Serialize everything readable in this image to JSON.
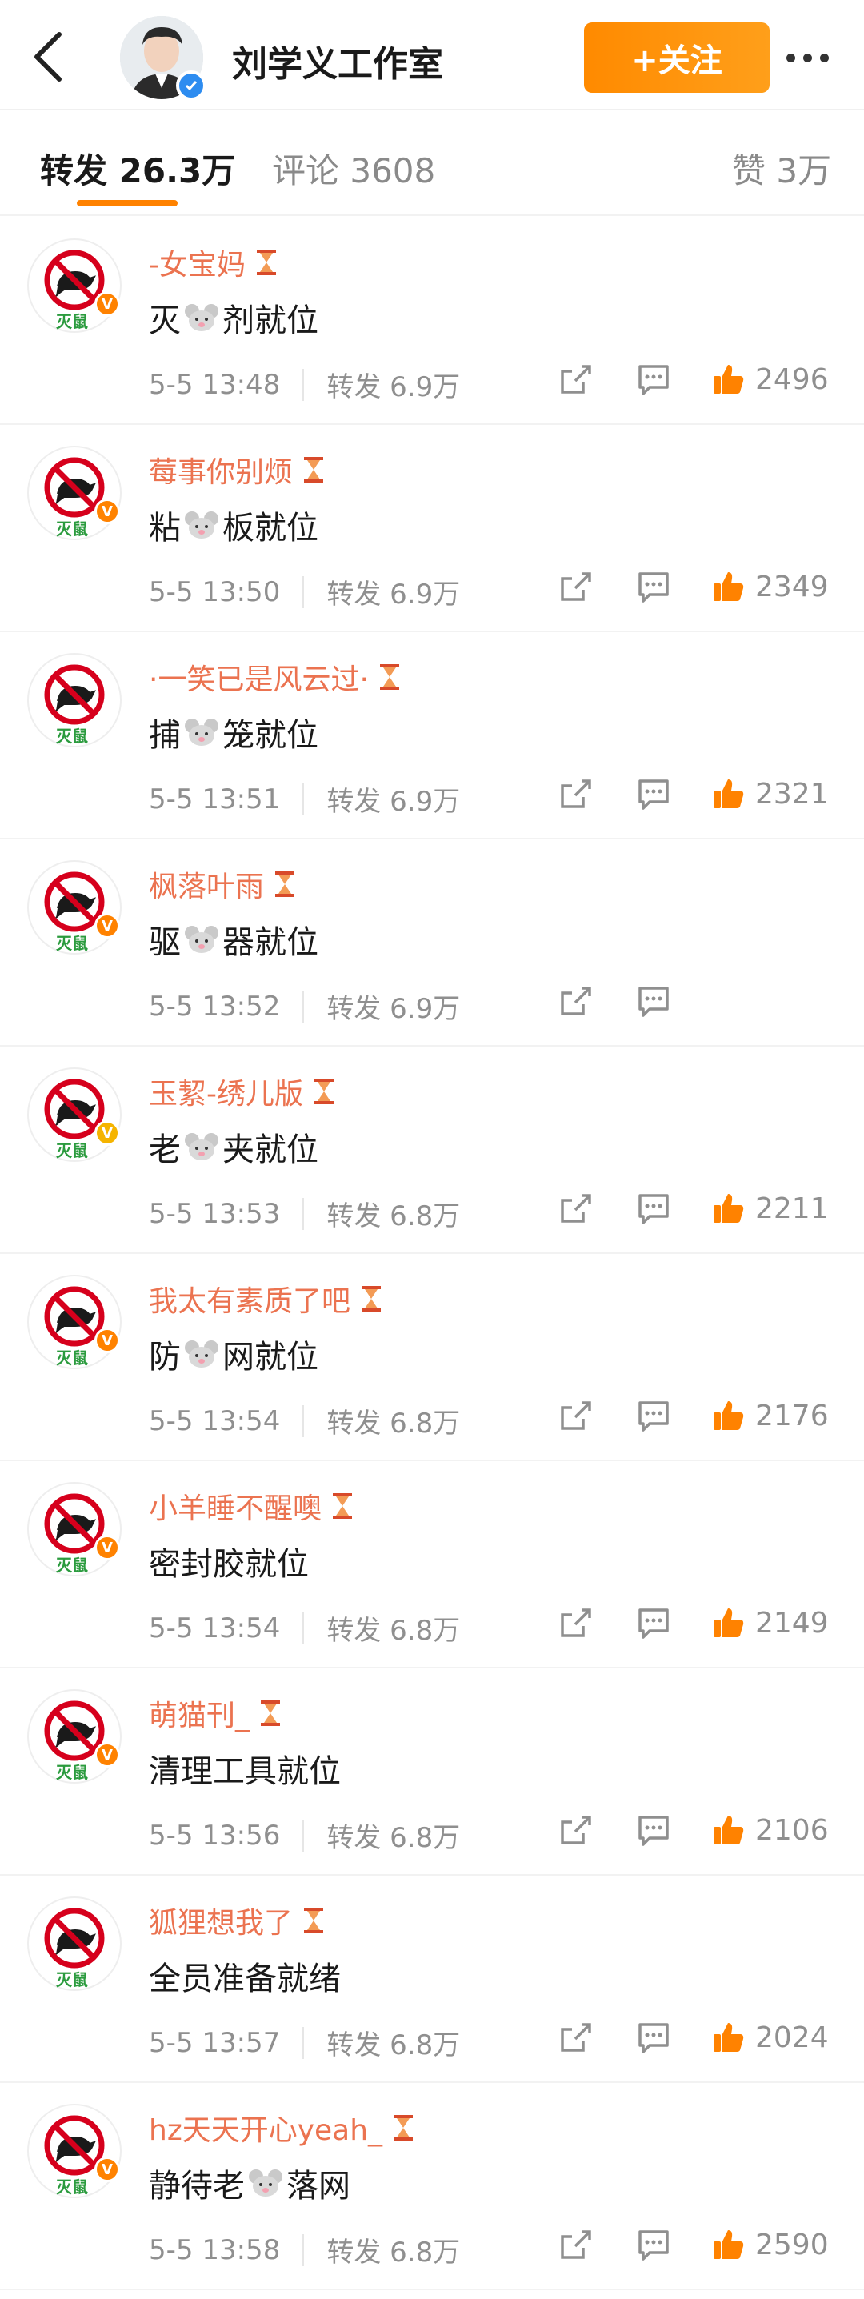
{
  "header": {
    "back_icon": "back-chevron-icon",
    "title": "刘学义工作室",
    "follow_label": "+关注",
    "more_icon": "more-dots-icon"
  },
  "tabs": [
    {
      "label": "转发 26.3万",
      "active": true
    },
    {
      "label": "评论 3608",
      "active": false
    },
    {
      "label": "赞 3万",
      "active": false
    }
  ],
  "avatar_badge_label": "灭鼠",
  "comments": [
    {
      "name": "-女宝妈",
      "text_before": "灭",
      "text_after": "剂就位",
      "time": "5-5 13:48",
      "repost": "转发 6.9万",
      "likes": "2496"
    },
    {
      "name": "莓事你别烦",
      "text_before": "粘",
      "text_after": "板就位",
      "time": "5-5 13:50",
      "repost": "转发 6.9万",
      "likes": "2349"
    },
    {
      "name": "·一笑已是风云过·",
      "text_before": "捕",
      "text_after": "笼就位",
      "time": "5-5 13:51",
      "repost": "转发 6.9万",
      "likes": "2321"
    },
    {
      "name": "枫落叶雨",
      "text_before": "驱",
      "text_after": "器就位",
      "time": "5-5 13:52",
      "repost": "转发 6.9万",
      "likes": ""
    },
    {
      "name": "玉絜-绣儿版",
      "text_before": "老",
      "text_after": "夹就位",
      "time": "5-5 13:53",
      "repost": "转发 6.8万",
      "likes": "2211"
    },
    {
      "name": "我太有素质了吧",
      "text_before": "防",
      "text_after": "网就位",
      "time": "5-5 13:54",
      "repost": "转发 6.8万",
      "likes": "2176"
    },
    {
      "name": "小羊睡不醒噢",
      "text_before": "密封胶就位",
      "text_after": "",
      "time": "5-5 13:54",
      "repost": "转发 6.8万",
      "likes": "2149"
    },
    {
      "name": "萌猫刊_",
      "text_before": "清理工具就位",
      "text_after": "",
      "time": "5-5 13:56",
      "repost": "转发 6.8万",
      "likes": "2106"
    },
    {
      "name": "狐狸想我了",
      "text_before": "全员准备就绪",
      "text_after": "",
      "time": "5-5 13:57",
      "repost": "转发 6.8万",
      "likes": "2024"
    },
    {
      "name": "hz天天开心yeah_",
      "text_before": "静待老",
      "text_after": "落网",
      "time": "5-5 13:58",
      "repost": "转发 6.8万",
      "likes": "2590"
    }
  ],
  "colors": {
    "accent": "#ff8200",
    "username": "#eb7350",
    "muted": "#8f8f8f"
  }
}
